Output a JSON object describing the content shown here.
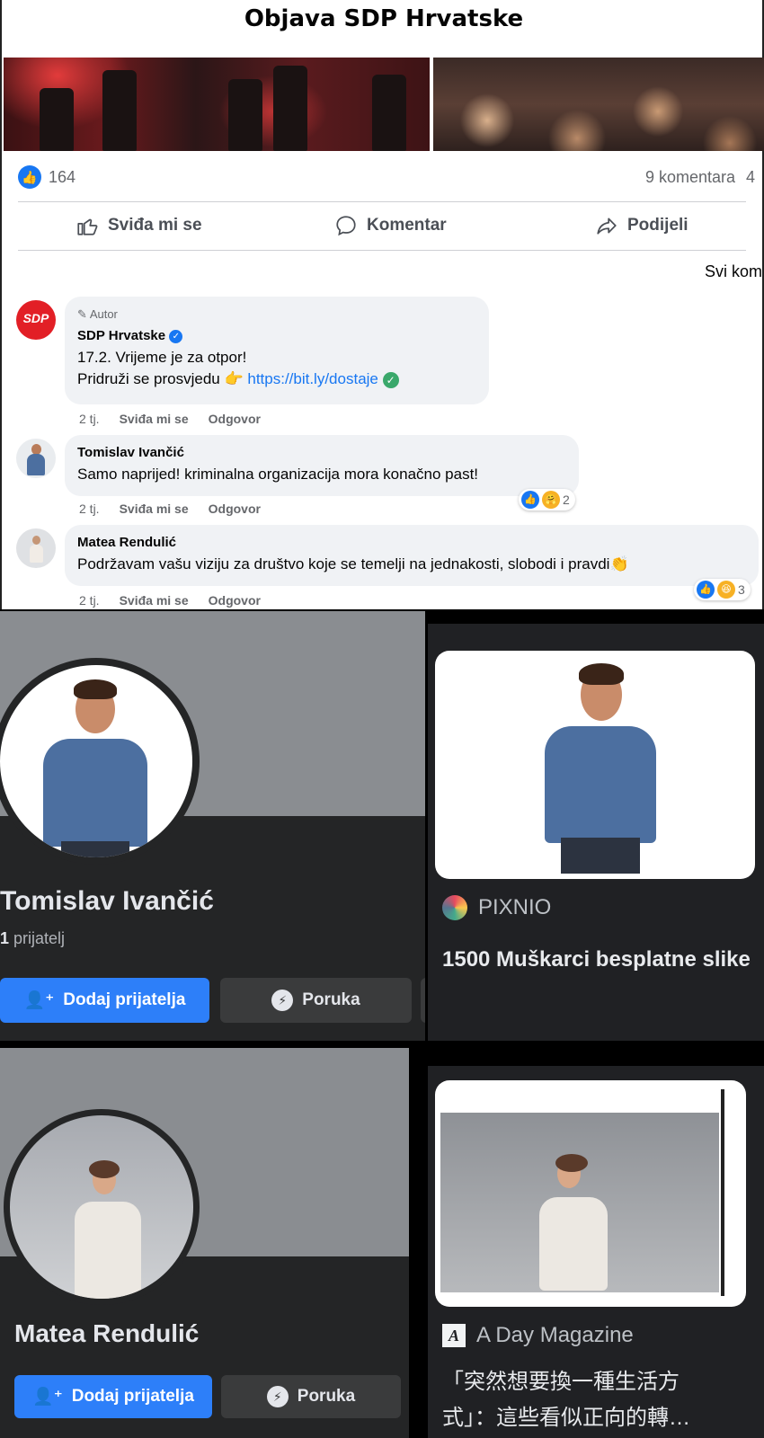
{
  "post": {
    "title": "Objava SDP Hrvatske",
    "like_count": "164",
    "comments_count": "9 komentara",
    "cut_trailing": "4",
    "actions": {
      "like": "Sviđa mi se",
      "comment": "Komentar",
      "share": "Podijeli"
    },
    "filter": "Svi kom"
  },
  "comments": [
    {
      "author_tag": "Autor",
      "name": "SDP Hrvatske",
      "line1": "17.2. Vrijeme je za otpor!",
      "line2_prefix": "Pridruži se prosvjedu 👉 ",
      "link": "https://bit.ly/dostaje",
      "avatar_text": "SDP",
      "time": "2 tj.",
      "like": "Sviđa mi se",
      "reply": "Odgovor"
    },
    {
      "name": "Tomislav Ivančić",
      "text": "Samo naprijed! kriminalna organizacija mora konačno past!",
      "time": "2 tj.",
      "like": "Sviđa mi se",
      "reply": "Odgovor",
      "reactions": "2"
    },
    {
      "name": "Matea Rendulić",
      "text": "Podržavam vašu viziju za društvo koje se temelji na jednakosti, slobodi i pravdi👏",
      "time": "2 tj.",
      "like": "Sviđa mi se",
      "reply": "Odgovor",
      "reactions": "3"
    }
  ],
  "profiles": [
    {
      "name": "Tomislav Ivančić",
      "friends_count": "1",
      "friends_label": " prijatelj",
      "add": "Dodaj prijatelja",
      "message": "Poruka"
    },
    {
      "name": "Matea Rendulić",
      "add": "Dodaj prijatelja",
      "message": "Poruka"
    }
  ],
  "results": [
    {
      "source": "PIXNIO",
      "title": "1500 Muškarci besplatne slike"
    },
    {
      "source": "A Day Magazine",
      "title": "「突然想要換一種生活方式」：這些看似正向的轉…"
    }
  ],
  "colors": {
    "facebook_blue": "#1877f2",
    "dark_bg": "#242526",
    "button_blue": "#2d7ff9"
  },
  "icons": [
    "like-icon",
    "comment-icon",
    "share-icon",
    "pencil-icon",
    "verified-icon",
    "add-friend-icon",
    "messenger-icon",
    "pixnio-icon",
    "a-day-magazine-icon"
  ]
}
